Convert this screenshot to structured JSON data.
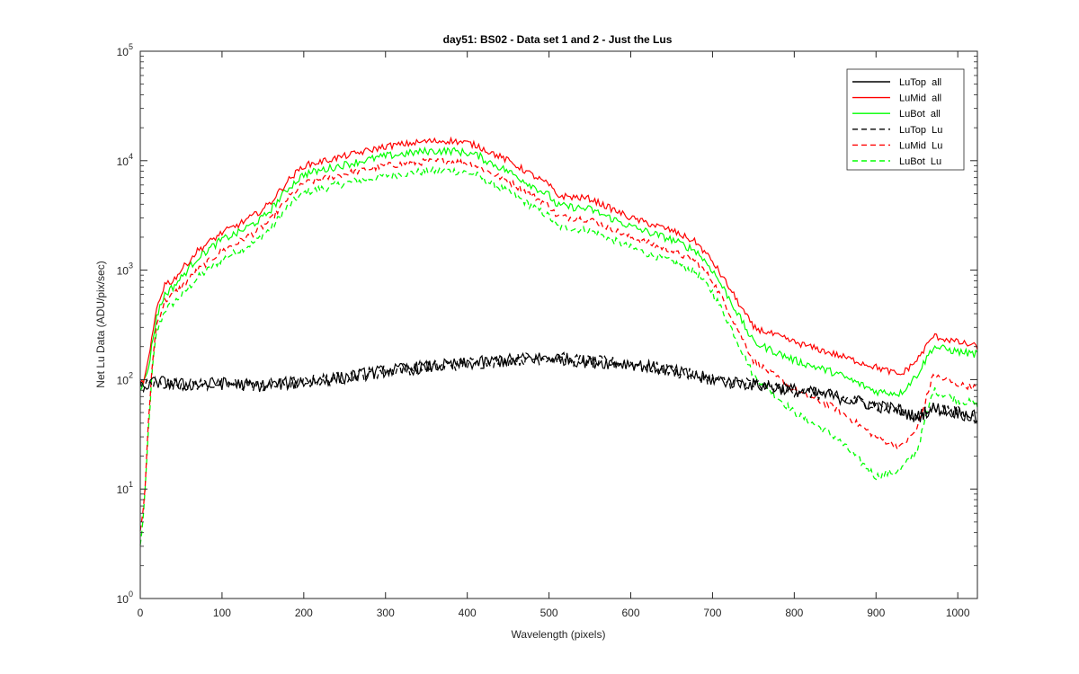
{
  "chart_data": {
    "type": "line",
    "title": "day51: BS02 - Data set 1 and 2 - Just the Lus",
    "xlabel": "Wavelength (pixels)",
    "ylabel": "Net Lu Data (ADU/pix/sec)",
    "xlim": [
      0,
      1024
    ],
    "ylim": [
      1,
      100000
    ],
    "yscale": "log",
    "xticks": [
      "0",
      "100",
      "200",
      "300",
      "400",
      "500",
      "600",
      "700",
      "800",
      "900",
      "1000"
    ],
    "yticks": [
      {
        "base": "10",
        "exp": "0"
      },
      {
        "base": "10",
        "exp": "1"
      },
      {
        "base": "10",
        "exp": "2"
      },
      {
        "base": "10",
        "exp": "3"
      },
      {
        "base": "10",
        "exp": "4"
      },
      {
        "base": "10",
        "exp": "5"
      }
    ],
    "grid": false,
    "legend_position": "top-right",
    "series": [
      {
        "name": "LuTop  all",
        "color": "#000000",
        "dash": "solid",
        "noise": 0.06,
        "x": [
          0,
          20,
          50,
          100,
          150,
          200,
          250,
          300,
          350,
          400,
          450,
          500,
          550,
          600,
          650,
          700,
          750,
          800,
          850,
          900,
          930,
          950,
          970,
          1000,
          1024
        ],
        "y": [
          85,
          95,
          90,
          92,
          88,
          95,
          105,
          120,
          130,
          140,
          150,
          160,
          145,
          140,
          120,
          100,
          90,
          80,
          70,
          58,
          52,
          45,
          55,
          50,
          45
        ]
      },
      {
        "name": "LuMid  all",
        "color": "#ff0000",
        "dash": "solid",
        "noise": 0.03,
        "x": [
          0,
          5,
          10,
          15,
          20,
          30,
          40,
          50,
          70,
          100,
          120,
          140,
          150,
          160,
          180,
          200,
          250,
          300,
          350,
          380,
          400,
          415,
          420,
          450,
          500,
          510,
          550,
          600,
          650,
          680,
          700,
          720,
          750,
          800,
          850,
          900,
          930,
          950,
          970,
          1000,
          1024
        ],
        "y": [
          90,
          100,
          150,
          250,
          450,
          750,
          800,
          1000,
          1500,
          2200,
          2600,
          3200,
          3600,
          4200,
          6500,
          9000,
          11000,
          13500,
          15000,
          15200,
          14500,
          13500,
          12800,
          10000,
          6000,
          4800,
          4500,
          3000,
          2300,
          1800,
          1200,
          700,
          300,
          220,
          170,
          130,
          110,
          150,
          250,
          220,
          200
        ]
      },
      {
        "name": "LuBot  all",
        "color": "#00ff00",
        "dash": "solid",
        "noise": 0.035,
        "x": [
          0,
          5,
          10,
          15,
          20,
          30,
          40,
          50,
          70,
          100,
          120,
          140,
          150,
          160,
          180,
          200,
          250,
          300,
          350,
          380,
          400,
          415,
          420,
          450,
          500,
          510,
          550,
          600,
          650,
          680,
          700,
          720,
          750,
          800,
          850,
          900,
          930,
          950,
          970,
          1000,
          1024
        ],
        "y": [
          85,
          95,
          130,
          220,
          380,
          600,
          700,
          850,
          1300,
          1900,
          2200,
          2700,
          3000,
          3600,
          5500,
          7500,
          9200,
          11000,
          12200,
          12300,
          11800,
          11000,
          10300,
          8000,
          4800,
          3900,
          3600,
          2500,
          1900,
          1500,
          1000,
          560,
          220,
          150,
          115,
          78,
          75,
          110,
          200,
          180,
          170
        ]
      },
      {
        "name": "LuTop  Lu",
        "color": "#000000",
        "dash": "dashed",
        "noise": 0.06,
        "x": [
          0,
          20,
          50,
          100,
          150,
          200,
          250,
          300,
          350,
          400,
          450,
          500,
          550,
          600,
          650,
          700,
          750,
          800,
          850,
          900,
          930,
          950,
          970,
          1000,
          1024
        ],
        "y": [
          85,
          95,
          90,
          92,
          88,
          95,
          105,
          120,
          130,
          140,
          150,
          160,
          145,
          140,
          120,
          100,
          90,
          80,
          70,
          58,
          52,
          45,
          55,
          50,
          45
        ]
      },
      {
        "name": "LuMid  Lu",
        "color": "#ff0000",
        "dash": "dashed",
        "noise": 0.03,
        "x": [
          0,
          5,
          10,
          15,
          20,
          30,
          40,
          50,
          70,
          100,
          120,
          140,
          150,
          160,
          180,
          200,
          250,
          300,
          350,
          380,
          400,
          415,
          420,
          450,
          500,
          510,
          550,
          600,
          650,
          680,
          700,
          720,
          750,
          800,
          850,
          900,
          930,
          950,
          970,
          1000,
          1024
        ],
        "y": [
          4,
          8,
          40,
          150,
          320,
          520,
          600,
          700,
          1000,
          1500,
          1800,
          2200,
          2500,
          2900,
          4500,
          6200,
          7600,
          9000,
          9800,
          9900,
          9500,
          8800,
          8300,
          6500,
          3900,
          3100,
          2900,
          2000,
          1500,
          1200,
          800,
          420,
          150,
          80,
          55,
          30,
          24,
          35,
          110,
          90,
          85
        ]
      },
      {
        "name": "LuBot  Lu",
        "color": "#00ff00",
        "dash": "dashed",
        "noise": 0.035,
        "x": [
          0,
          5,
          10,
          15,
          20,
          30,
          40,
          50,
          70,
          100,
          120,
          140,
          150,
          160,
          180,
          200,
          250,
          300,
          350,
          380,
          400,
          415,
          420,
          450,
          500,
          510,
          550,
          600,
          650,
          680,
          700,
          720,
          750,
          800,
          850,
          900,
          930,
          950,
          970,
          1000,
          1024
        ],
        "y": [
          3,
          7,
          35,
          130,
          270,
          430,
          500,
          580,
          850,
          1250,
          1500,
          1800,
          2100,
          2400,
          3800,
          5100,
          6200,
          7300,
          8000,
          8100,
          7800,
          7200,
          6700,
          5200,
          3100,
          2500,
          2300,
          1600,
          1200,
          950,
          630,
          330,
          110,
          50,
          30,
          13,
          15,
          22,
          80,
          65,
          60
        ]
      }
    ]
  }
}
